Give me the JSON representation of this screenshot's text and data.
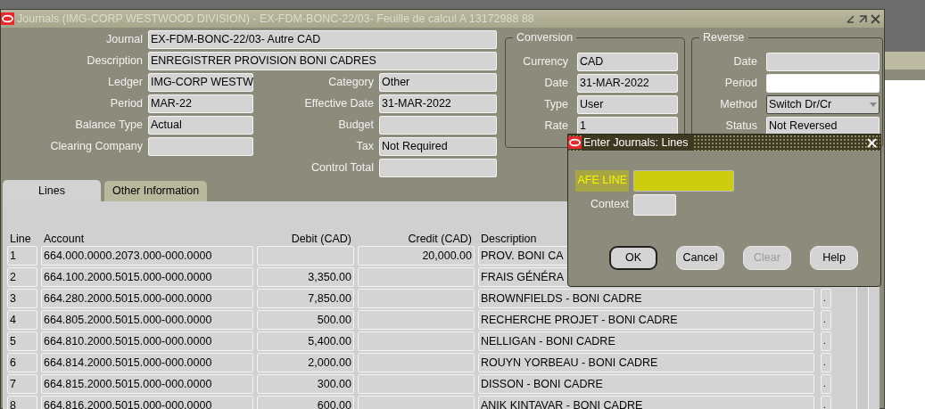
{
  "window": {
    "title": "Journals (IMG-CORP WESTWOOD DIVISION) - EX-FDM-BONC-22/03- Feuille de calcul A 13172988 88"
  },
  "journal": {
    "label": "Journal",
    "value": "EX-FDM-BONC-22/03- Autre CAD"
  },
  "description": {
    "label": "Description",
    "value": "ENREGISTRER PROVISION BONI CADRES"
  },
  "left_fields": [
    {
      "label": "Ledger",
      "value": "IMG-CORP WESTW"
    },
    {
      "label": "Period",
      "value": "MAR-22"
    },
    {
      "label": "Balance Type",
      "value": "Actual"
    },
    {
      "label": "Clearing Company"
    }
  ],
  "right_fields": [
    {
      "label": "Category",
      "value": "Other"
    },
    {
      "label": "Effective Date",
      "value": "31-MAR-2022"
    },
    {
      "label": "Budget"
    },
    {
      "label": "Tax",
      "value": "Not Required"
    },
    {
      "label": "Control Total"
    }
  ],
  "conversion": {
    "title": "Conversion",
    "fields": [
      {
        "label": "Currency",
        "value": "CAD"
      },
      {
        "label": "Date",
        "value": "31-MAR-2022"
      },
      {
        "label": "Type",
        "value": "User"
      },
      {
        "label": "Rate",
        "value": "1"
      }
    ]
  },
  "reverse": {
    "title": "Reverse",
    "fields": [
      {
        "label": "Date",
        "kind": "text",
        "editable": false
      },
      {
        "label": "Period",
        "kind": "text",
        "editable": true
      },
      {
        "label": "Method",
        "value": "Switch Dr/Cr",
        "kind": "dropdown",
        "editable": false
      },
      {
        "label": "Status",
        "value": "Not Reversed",
        "kind": "text",
        "editable": false
      }
    ]
  },
  "tabs": [
    {
      "label": "Lines",
      "selected": true
    },
    {
      "label": "Other Information",
      "selected": false
    }
  ],
  "table": {
    "columns": [
      "Line",
      "Account",
      "Debit (CAD)",
      "Credit (CAD)",
      "Description"
    ],
    "rows": [
      {
        "line": "1",
        "account": "664.000.0000.2073.000-000.0000",
        "credit": "20,000.00",
        "description": "PROV. BONI CA"
      },
      {
        "line": "2",
        "account": "664.100.2000.5015.000-000.0000",
        "debit": "3,350.00",
        "description": "FRAIS GÉNÉRA"
      },
      {
        "line": "3",
        "account": "664.280.2000.5015.000-000.0000",
        "debit": "7,850.00",
        "description": "BROWNFIELDS - BONI CADRE",
        "column_6": "."
      },
      {
        "line": "4",
        "account": "664.805.2000.5015.000-000.0000",
        "debit": "500.00",
        "description": "RECHERCHE PROJET - BONI CADRE",
        "column_6": "."
      },
      {
        "line": "5",
        "account": "664.810.2000.5015.000-000.0000",
        "debit": "5,400.00",
        "description": "NELLIGAN - BONI CADRE",
        "column_6": "."
      },
      {
        "line": "6",
        "account": "664.814.2000.5015.000-000.0000",
        "debit": "2,000.00",
        "description": "ROUYN YORBEAU - BONI CADRE",
        "column_6": "."
      },
      {
        "line": "7",
        "account": "664.815.2000.5015.000-000.0000",
        "debit": "300.00",
        "description": "DISSON - BONI CADRE",
        "column_6": "."
      },
      {
        "line": "8",
        "account": "664.816.2000.5015.000-000.0000",
        "debit": "600.00",
        "description": "ANIK KINTAVAR - BONI CADRE",
        "column_6": "."
      }
    ]
  },
  "dialog": {
    "title": "Enter Journals: Lines",
    "fields": [
      {
        "label": "AFE LINE",
        "highlighted": true
      },
      {
        "label": "Context",
        "highlighted": false
      }
    ],
    "buttons": [
      {
        "label": "OK",
        "focused": true,
        "disabled": false
      },
      {
        "label": "Cancel",
        "focused": false,
        "disabled": false
      },
      {
        "label": "Clear",
        "focused": false,
        "disabled": true
      },
      {
        "label": "Help",
        "focused": false,
        "disabled": false
      }
    ]
  }
}
